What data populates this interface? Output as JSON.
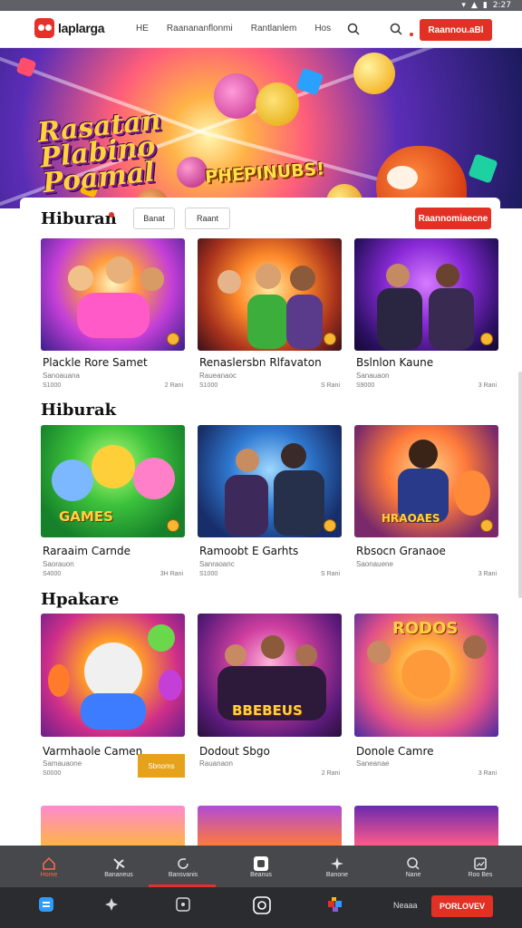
{
  "status": {
    "time": "2:27"
  },
  "topnav": {
    "brand": "laplarga",
    "links": [
      "HE",
      "Raanananflonmi",
      "Rantlanlem",
      "Hos"
    ],
    "cta": "Raannou.aBl"
  },
  "hero": {
    "title": "Rasatan Plabino Poamal",
    "subtitle": "PHEPINUBS!"
  },
  "section1": {
    "title": "Hiburan",
    "filters": [
      "Banat",
      "Raant"
    ],
    "cta": "Raannomiaecne"
  },
  "sections": [
    {
      "title": "",
      "cards": [
        {
          "name": "Plackle Rore Samet",
          "sub": "Sanoauana",
          "meta_l": "S1000",
          "meta_r": "2 Rani",
          "banner": ""
        },
        {
          "name": "Renaslersbn Rlfavaton",
          "sub": "Raueanaoc",
          "meta_l": "S1000",
          "meta_r": "S Rani",
          "banner": ""
        },
        {
          "name": "Bslnlon Kaune",
          "sub": "Sanauaon",
          "meta_l": "S9000",
          "meta_r": "3 Rani",
          "banner": ""
        }
      ]
    },
    {
      "title": "Hiburak",
      "cards": [
        {
          "name": "Raraaim Carnde",
          "sub": "Saorauon",
          "meta_l": "S4000",
          "meta_r": "3H Rani",
          "banner": "GAMES"
        },
        {
          "name": "Ramoobt E Garhts",
          "sub": "Sanraoanc",
          "meta_l": "S1000",
          "meta_r": "S Rani",
          "banner": ""
        },
        {
          "name": "Rbsocn Granaoe",
          "sub": "Saonauene",
          "meta_l": "",
          "meta_r": "3 Rani",
          "banner": "HRAOAES"
        }
      ]
    },
    {
      "title": "Hpakare",
      "cards": [
        {
          "name": "Varmhaole Camen",
          "sub": "Samauaone",
          "meta_l": "S0000",
          "meta_r": "",
          "banner": ""
        },
        {
          "name": "Dodout Sbgo",
          "sub": "Rauanaon",
          "meta_l": "",
          "meta_r": "2 Rani",
          "banner": "BBEBEUS"
        },
        {
          "name": "Donole Camre",
          "sub": "Saneanae",
          "meta_l": "",
          "meta_r": "3 Rani",
          "banner": "RODOS"
        }
      ]
    }
  ],
  "yellow_badge": "Sbnoms",
  "tabbar": [
    {
      "label": "Home",
      "icon": "home-icon"
    },
    {
      "label": "Bananeus",
      "icon": "fan-icon"
    },
    {
      "label": "Bansvanis",
      "icon": "refresh-icon"
    },
    {
      "label": "Beanus",
      "icon": "box-icon"
    },
    {
      "label": "Banone",
      "icon": "spark-icon"
    },
    {
      "label": "Nane",
      "icon": "search-icon"
    },
    {
      "label": "Roo Bes",
      "icon": "image-icon"
    }
  ],
  "sysbar": {
    "label": "Neaaa",
    "cta": "PORLOVEV"
  }
}
